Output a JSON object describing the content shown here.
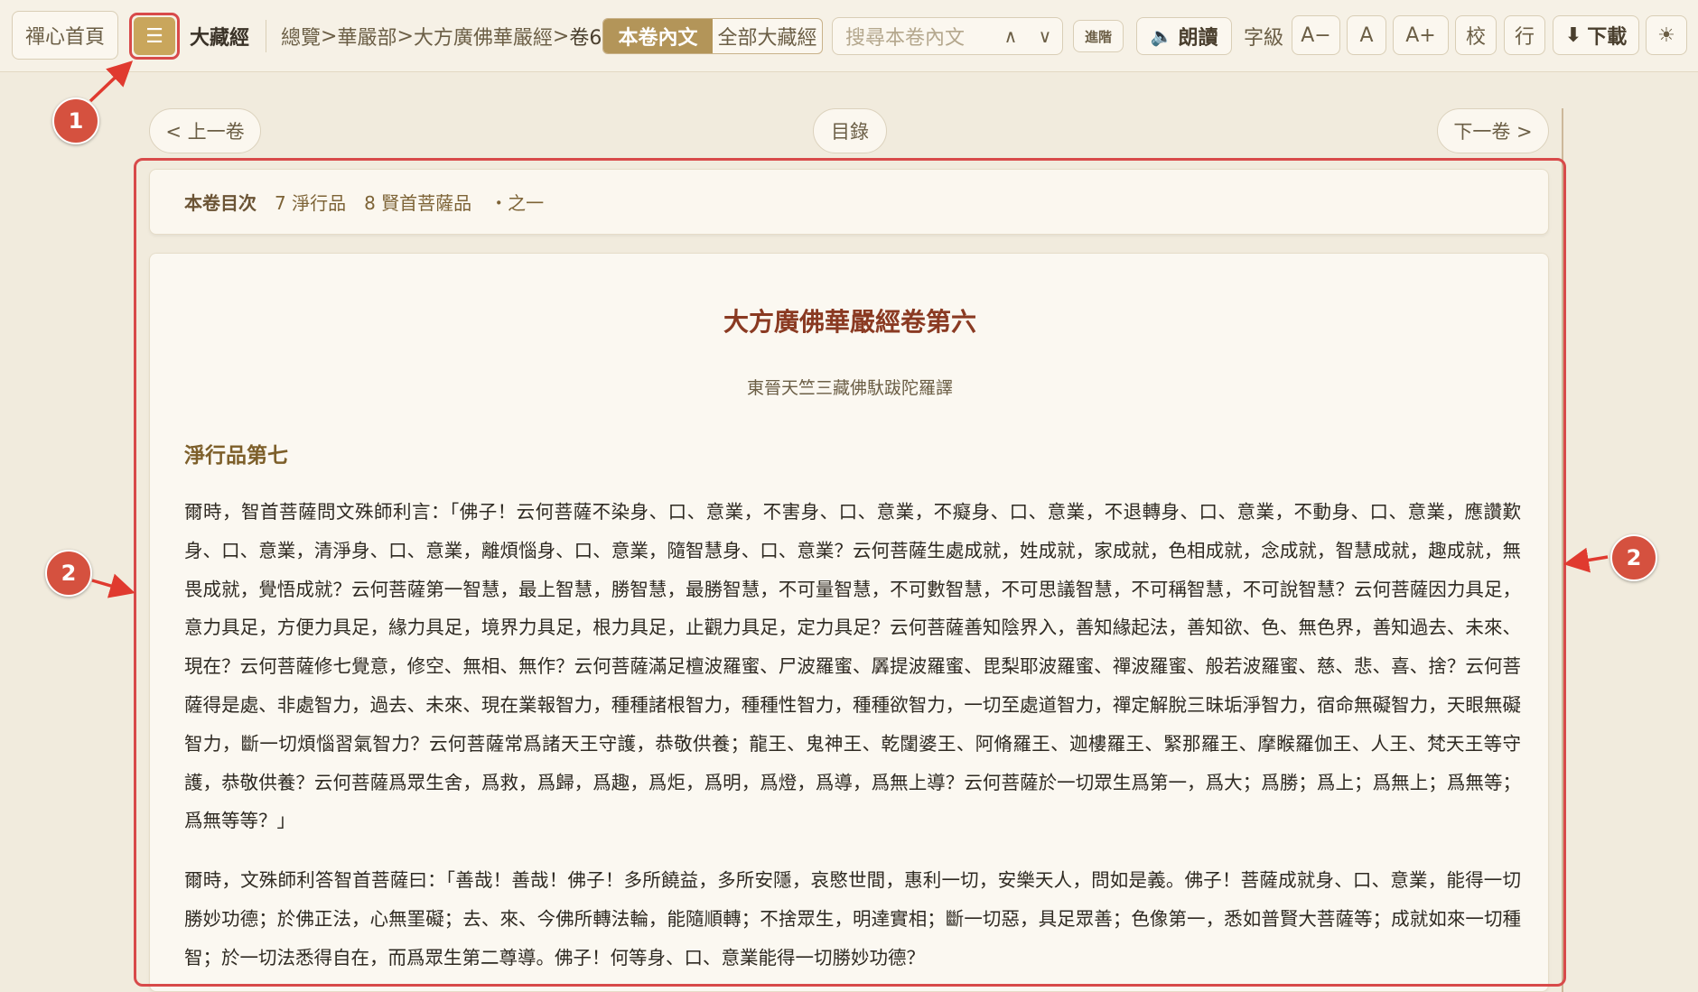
{
  "toolbar": {
    "home": "禪心首頁",
    "menu_icon": "☰",
    "brand": "大藏經",
    "breadcrumb": [
      "總覽",
      "華嚴部",
      "大方廣佛華嚴經",
      "卷6"
    ],
    "breadcrumb_sep": ">",
    "scope_tabs": [
      "本卷內文",
      "全部大藏經"
    ],
    "search_placeholder": "搜尋本卷內文",
    "search_up": "∧",
    "search_down": "∨",
    "advanced": "進階",
    "read_aloud": "朗讀",
    "speaker_icon": "🔈",
    "font_size_label": "字級",
    "font_smaller": "A−",
    "font_normal": "A",
    "font_larger": "A+",
    "proofread": "校",
    "line": "行",
    "download": "下載",
    "download_icon": "⬇",
    "theme_icon": "☀"
  },
  "nav": {
    "prev": "< 上一卷",
    "toc": "目錄",
    "next": "下一卷 >"
  },
  "catalog": {
    "lead": "本卷目次",
    "items": [
      "7 淨行品",
      "8 賢首菩薩品",
      "・之一"
    ]
  },
  "content": {
    "title": "大方廣佛華嚴經卷第六",
    "translator": "東晉天竺三藏佛馱跋陀羅譯",
    "chapter": "淨行品第七",
    "paragraphs": [
      "爾時，智首菩薩問文殊師利言：「佛子！云何菩薩不染身、口、意業，不害身、口、意業，不癡身、口、意業，不退轉身、口、意業，不動身、口、意業，應讚歎身、口、意業，清淨身、口、意業，離煩惱身、口、意業，隨智慧身、口、意業？云何菩薩生處成就，姓成就，家成就，色相成就，念成就，智慧成就，趣成就，無畏成就，覺悟成就？云何菩薩第一智慧，最上智慧，勝智慧，最勝智慧，不可量智慧，不可數智慧，不可思議智慧，不可稱智慧，不可說智慧？云何菩薩因力具足，意力具足，方便力具足，緣力具足，境界力具足，根力具足，止觀力具足，定力具足？云何菩薩善知陰界入，善知緣起法，善知欲、色、無色界，善知過去、未來、現在？云何菩薩修七覺意，修空、無相、無作？云何菩薩滿足檀波羅蜜、尸波羅蜜、羼提波羅蜜、毘梨耶波羅蜜、禪波羅蜜、般若波羅蜜、慈、悲、喜、捨？云何菩薩得是處、非處智力，過去、未來、現在業報智力，種種諸根智力，種種性智力，種種欲智力，一切至處道智力，禪定解脫三昧垢淨智力，宿命無礙智力，天眼無礙智力，斷一切煩惱習氣智力？云何菩薩常爲諸天王守護，恭敬供養；龍王、鬼神王、乾闥婆王、阿脩羅王、迦樓羅王、緊那羅王、摩睺羅伽王、人王、梵天王等守護，恭敬供養？云何菩薩爲眾生舍，爲救，爲歸，爲趣，爲炬，爲明，爲燈，爲導，爲無上導？云何菩薩於一切眾生爲第一，爲大；爲勝；爲上；爲無上；爲無等；爲無等等？」",
      "爾時，文殊師利答智首菩薩曰：「善哉！善哉！佛子！多所饒益，多所安隱，哀愍世間，惠利一切，安樂天人，問如是義。佛子！菩薩成就身、口、意業，能得一切勝妙功德；於佛正法，心無罣礙；去、來、今佛所轉法輪，能隨順轉；不捨眾生，明達實相；斷一切惡，具足眾善；色像第一，悉如普賢大菩薩等；成就如來一切種智；於一切法悉得自在，而爲眾生第二尊導。佛子！何等身、口、意業能得一切勝妙功德？"
    ]
  },
  "annotations": {
    "badge1": "1",
    "badge2": "2",
    "highlight_color": "#d84a4a"
  }
}
